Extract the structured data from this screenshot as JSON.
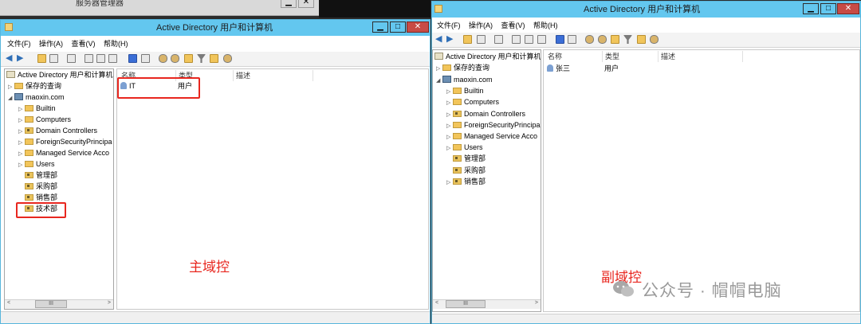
{
  "background_window": {
    "title": "服务器管理器"
  },
  "main_window": {
    "title": "Active Directory 用户和计算机",
    "menu": [
      "文件(F)",
      "操作(A)",
      "查看(V)",
      "帮助(H)"
    ],
    "controls": {
      "minimize": "▁",
      "maximize": "□",
      "close": "✕"
    },
    "tree": {
      "root": "Active Directory 用户和计算机",
      "saved_queries": "保存的查询",
      "domain": "maoxin.com",
      "children": [
        "Builtin",
        "Computers",
        "Domain Controllers",
        "ForeignSecurityPrincipa",
        "Managed Service Acco",
        "Users",
        "管理部",
        "采购部",
        "销售部",
        "技术部"
      ]
    },
    "columns": [
      "名称",
      "类型",
      "描述"
    ],
    "rows": [
      {
        "name": "IT",
        "type": "用户"
      }
    ],
    "caption": "主域控",
    "scroll": {
      "left": "<",
      "right": ">",
      "thumb": "III"
    }
  },
  "sub_window": {
    "title": "Active Directory 用户和计算机",
    "menu": [
      "文件(F)",
      "操作(A)",
      "查看(V)",
      "帮助(H)"
    ],
    "controls": {
      "minimize": "▁",
      "maximize": "□",
      "close": "✕"
    },
    "tree": {
      "root": "Active Directory 用户和计算机",
      "saved_queries": "保存的查询",
      "domain": "maoxin.com",
      "children": [
        "Builtin",
        "Computers",
        "Domain Controllers",
        "ForeignSecurityPrincipa",
        "Managed Service Acco",
        "Users",
        "管理部",
        "采购部",
        "销售部"
      ]
    },
    "columns": [
      "名称",
      "类型",
      "描述"
    ],
    "rows": [
      {
        "name": "张三",
        "type": "用户"
      }
    ],
    "caption": "副域控",
    "scroll": {
      "left": "<",
      "right": ">",
      "thumb": "III"
    }
  },
  "watermark": "公众号 · 帽帽电脑",
  "colors": {
    "titlebar": "#63c7ef",
    "close": "#c74b45",
    "highlight": "#e8271f"
  }
}
